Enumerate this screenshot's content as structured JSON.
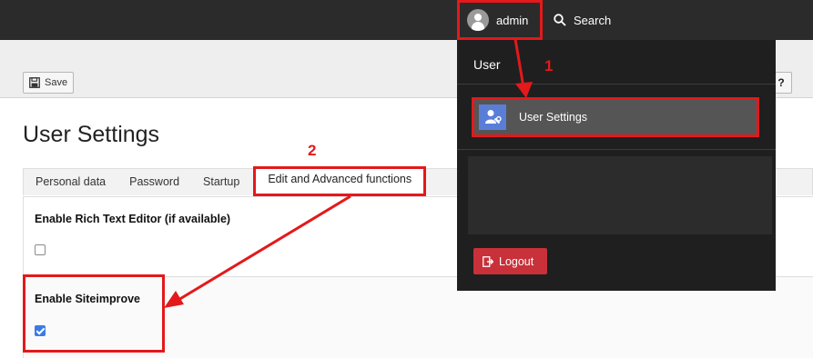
{
  "header": {
    "username": "admin",
    "search_label": "Search"
  },
  "toolbar": {
    "save_label": "Save",
    "help_label": "?"
  },
  "main": {
    "title": "User Settings",
    "tabs": [
      {
        "label": "Personal data"
      },
      {
        "label": "Password"
      },
      {
        "label": "Startup"
      },
      {
        "label": "Edit and Advanced functions",
        "active": true
      }
    ],
    "fields": [
      {
        "label": "Enable Rich Text Editor (if available)",
        "checked": false
      },
      {
        "label": "Enable Siteimprove",
        "checked": true
      }
    ]
  },
  "dropdown": {
    "title": "User",
    "item_label": "User Settings",
    "logout_label": "Logout"
  },
  "annotations": {
    "step1": "1",
    "step2": "2"
  },
  "colors": {
    "annotation_red": "#e3191b",
    "topbar": "#2b2b2b",
    "logout": "#c8313a",
    "checkbox_checked": "#3a7be6"
  }
}
